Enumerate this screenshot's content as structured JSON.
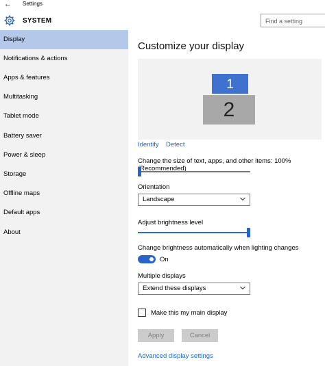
{
  "window": {
    "title": "Settings"
  },
  "header": {
    "title": "SYSTEM",
    "search_placeholder": "Find a setting"
  },
  "sidebar": {
    "items": [
      {
        "label": "Display",
        "active": true
      },
      {
        "label": "Notifications & actions"
      },
      {
        "label": "Apps & features"
      },
      {
        "label": "Multitasking"
      },
      {
        "label": "Tablet mode"
      },
      {
        "label": "Battery saver"
      },
      {
        "label": "Power & sleep"
      },
      {
        "label": "Storage"
      },
      {
        "label": "Offline maps"
      },
      {
        "label": "Default apps"
      },
      {
        "label": "About"
      }
    ]
  },
  "main": {
    "title": "Customize your display",
    "monitors": {
      "primary": "1",
      "secondary": "2"
    },
    "identify_label": "Identify",
    "detect_label": "Detect",
    "scale_label": "Change the size of text, apps, and other items: 100% (Recommended)",
    "scale_value_percent": 0,
    "orientation_label": "Orientation",
    "orientation_value": "Landscape",
    "brightness_label": "Adjust brightness level",
    "brightness_value_percent": 100,
    "auto_brightness_label": "Change brightness automatically when lighting changes",
    "auto_brightness_state": "On",
    "multiple_displays_label": "Multiple displays",
    "multiple_displays_value": "Extend these displays",
    "main_display_label": "Make this my main display",
    "apply_label": "Apply",
    "cancel_label": "Cancel",
    "advanced_link": "Advanced display settings"
  },
  "colors": {
    "accent": "#2a64c8",
    "sidebar_bg": "#f2f2f2",
    "sidebar_active": "#b4c8ea",
    "link": "#1f63c4"
  }
}
